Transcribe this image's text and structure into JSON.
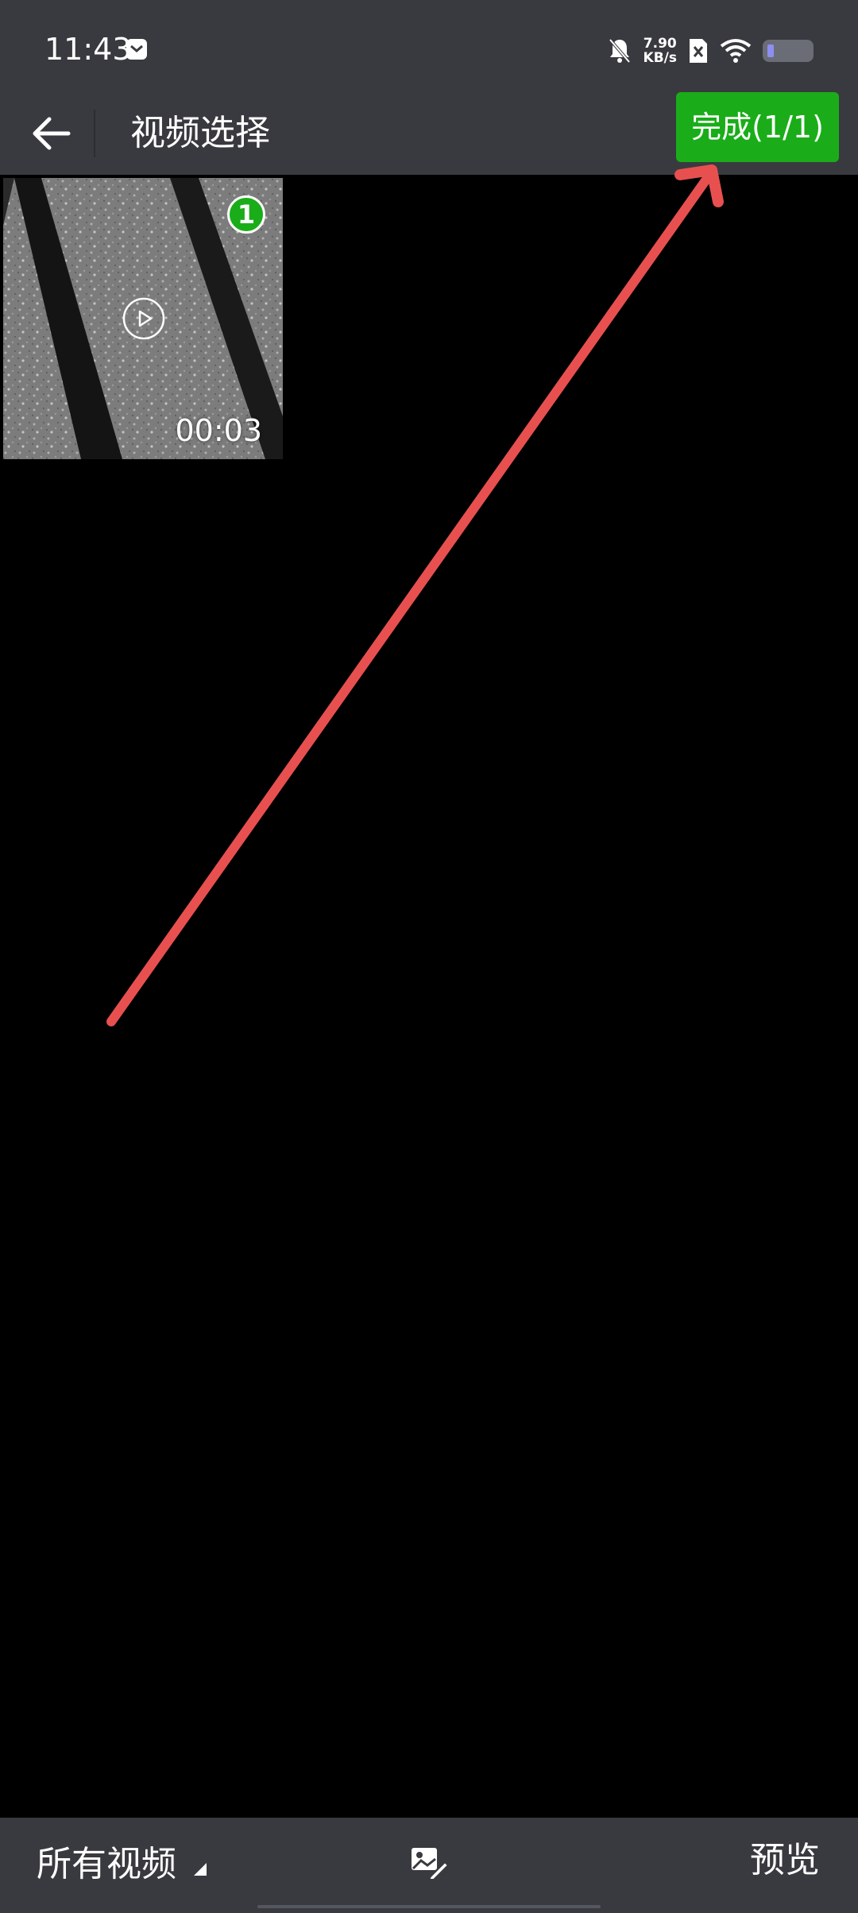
{
  "status_bar": {
    "time": "11:43",
    "net_speed_value": "7.90",
    "net_speed_unit": "KB/s",
    "battery_level": 0.15
  },
  "app_bar": {
    "title": "视频选择",
    "done_label": "完成(1/1)"
  },
  "videos": [
    {
      "selected_index": "1",
      "duration": "00:03"
    }
  ],
  "bottom_bar": {
    "album_label": "所有视频",
    "preview_label": "预览"
  },
  "colors": {
    "bar_background": "#393a3f",
    "accent_green": "#1aad19",
    "annotation_red": "#e85050"
  }
}
